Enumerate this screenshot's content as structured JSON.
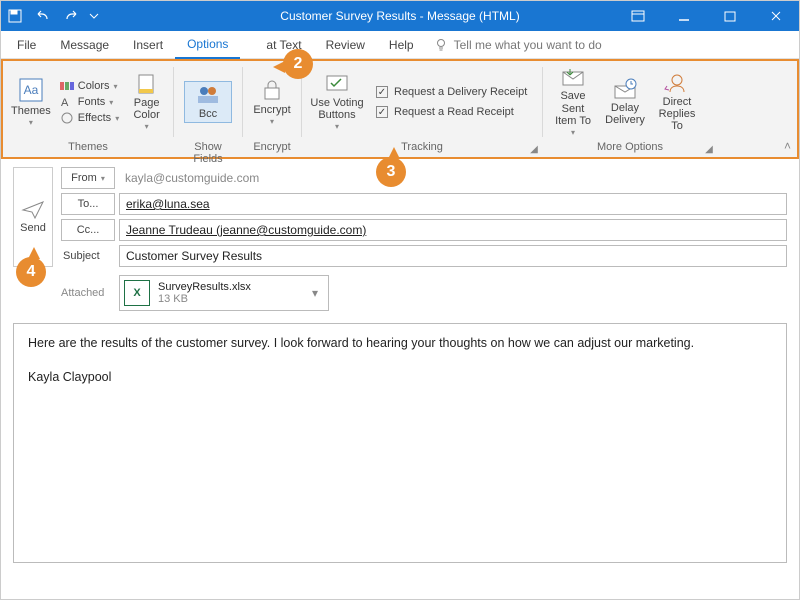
{
  "title": "Customer Survey Results  -  Message (HTML)",
  "menu": {
    "items": [
      "File",
      "Message",
      "Insert",
      "Options",
      "at Text",
      "Review",
      "Help"
    ],
    "active_index": 3,
    "tellme": "Tell me what you want to do"
  },
  "ribbon": {
    "themes": {
      "label": "Themes",
      "themes_btn": "Themes",
      "colors": "Colors",
      "fonts": "Fonts",
      "effects": "Effects",
      "page_color": "Page\nColor"
    },
    "show_fields": {
      "label": "Show Fields",
      "bcc": "Bcc"
    },
    "encrypt": {
      "label": "Encrypt",
      "btn": "Encrypt"
    },
    "tracking": {
      "label": "Tracking",
      "voting": "Use Voting\nButtons",
      "delivery": "Request a Delivery Receipt",
      "read": "Request a Read Receipt"
    },
    "more": {
      "label": "More Options",
      "save_sent": "Save Sent\nItem To",
      "delay": "Delay\nDelivery",
      "direct": "Direct\nReplies To"
    }
  },
  "compose": {
    "send": "Send",
    "from_label": "From",
    "from": "kayla@customguide.com",
    "to_label": "To...",
    "to": "erika@luna.sea",
    "cc_label": "Cc...",
    "cc": "Jeanne Trudeau (jeanne@customguide.com)",
    "subject_label": "Subject",
    "subject": "Customer Survey Results",
    "attached_label": "Attached",
    "attachment": {
      "name": "SurveyResults.xlsx",
      "size": "13 KB"
    },
    "body_line1": "Here are the results of the customer survey. I look forward to hearing your thoughts on how we can adjust our marketing.",
    "body_sig": "Kayla Claypool"
  },
  "badges": {
    "b2": "2",
    "b3": "3",
    "b4": "4"
  }
}
